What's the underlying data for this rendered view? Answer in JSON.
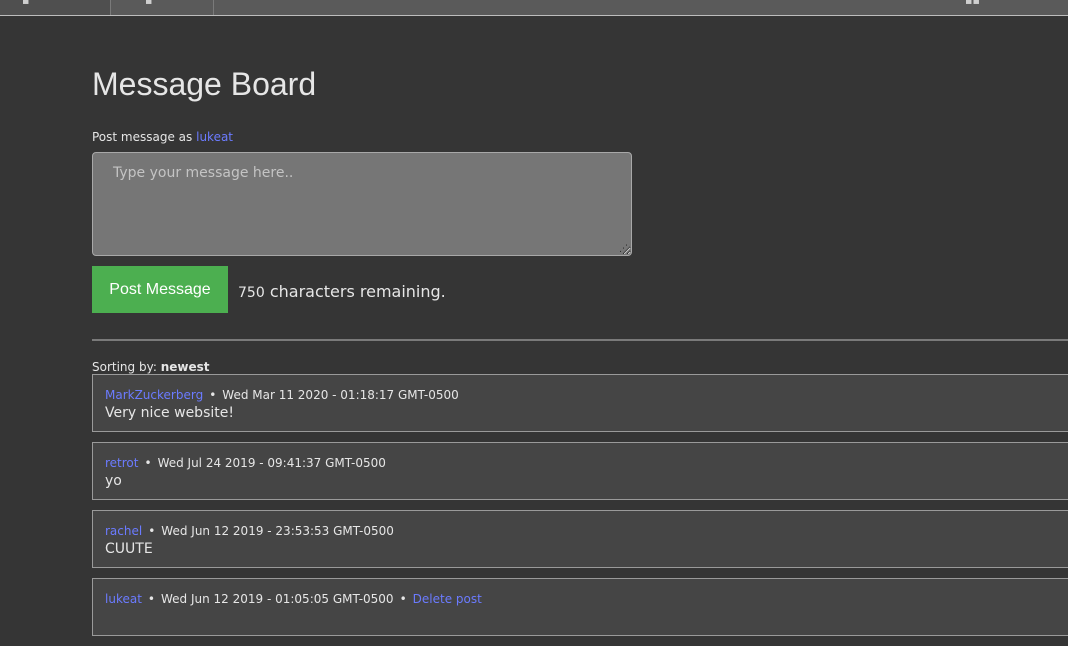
{
  "header": {
    "title": "Message Board"
  },
  "composer": {
    "post_as_label": "Post message as",
    "username": "lukeat",
    "placeholder": "Type your message here..",
    "button_label": "Post Message",
    "remaining_count": "750",
    "remaining_label": "characters remaining."
  },
  "sorting": {
    "label": "Sorting by:",
    "value": "newest"
  },
  "posts": [
    {
      "author": "MarkZuckerberg",
      "timestamp": "Wed Mar 11 2020 - 01:18:17 GMT-0500",
      "body": "Very nice website!"
    },
    {
      "author": "retrot",
      "timestamp": "Wed Jul 24 2019 - 09:41:37 GMT-0500",
      "body": "yo"
    },
    {
      "author": "rachel",
      "timestamp": "Wed Jun 12 2019 - 23:53:53 GMT-0500",
      "body": "CUUTE"
    },
    {
      "author": "lukeat",
      "timestamp": "Wed Jun 12 2019 - 01:05:05 GMT-0500",
      "delete_label": "Delete post",
      "body": ""
    }
  ],
  "colors": {
    "background": "#353535",
    "link": "#6b7bff",
    "button": "#4caf50",
    "post_background": "#454545"
  }
}
